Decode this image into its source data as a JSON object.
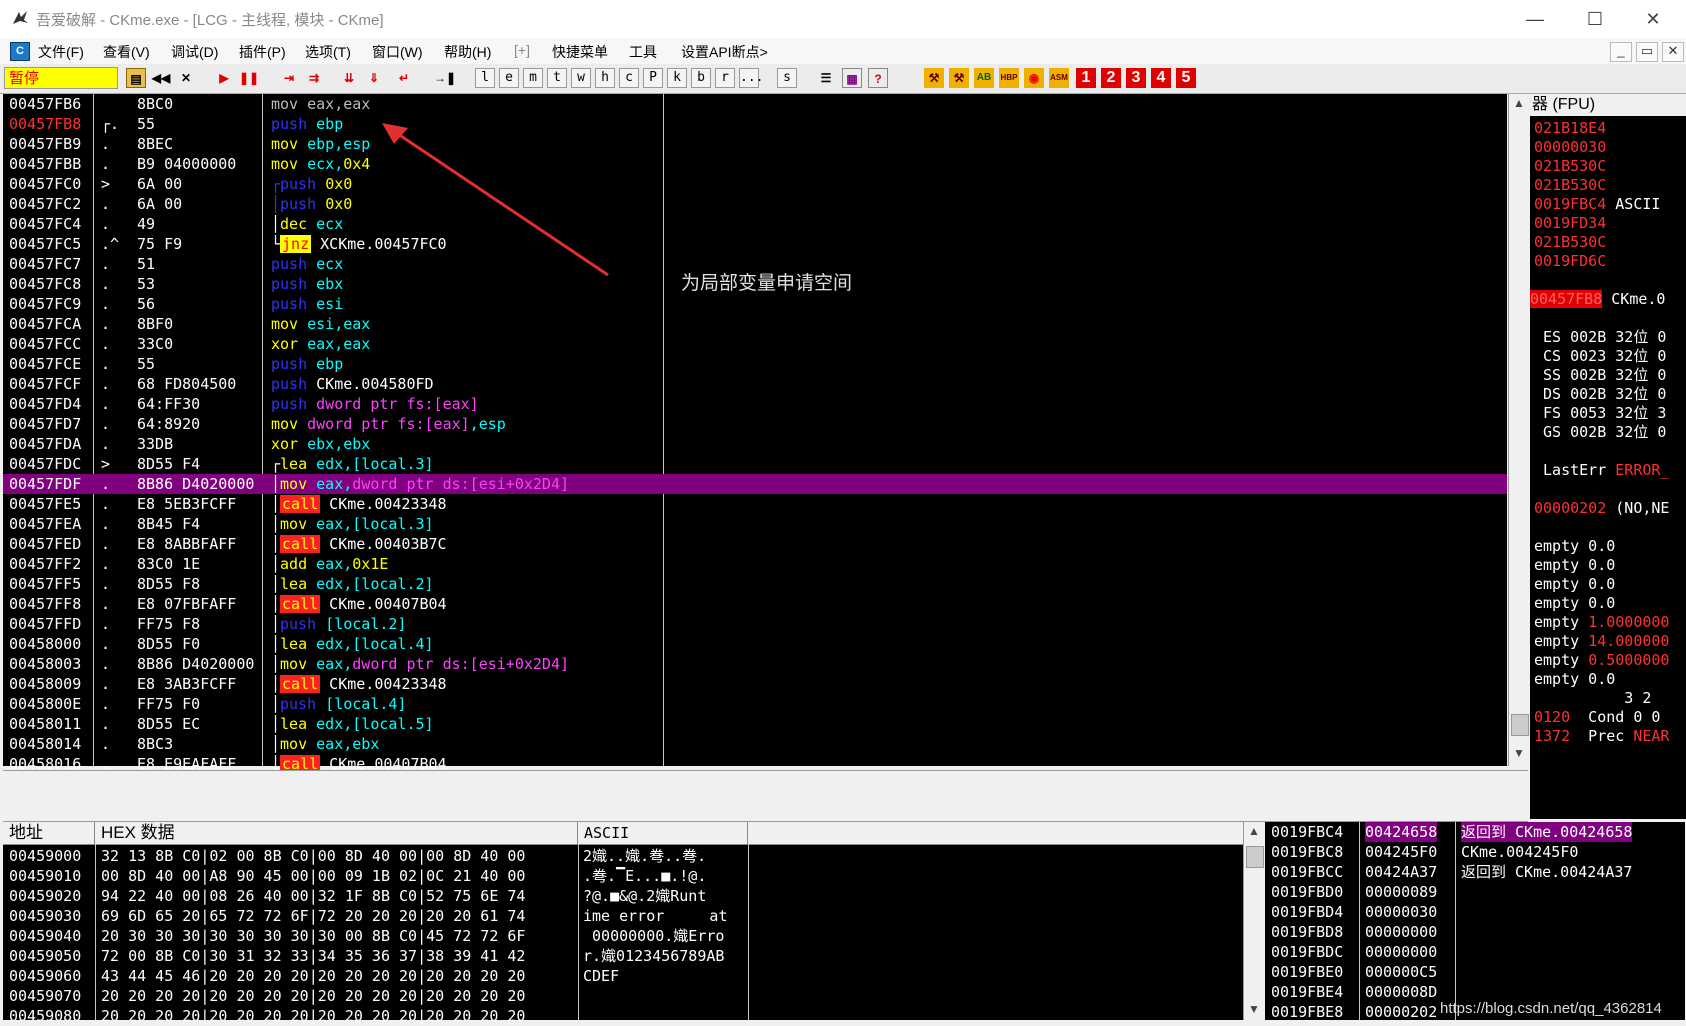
{
  "window": {
    "title": "吾爱破解 - CKme.exe - [LCG - 主线程, 模块 - CKme]",
    "controls": {
      "minimize": "—",
      "maximize": "☐",
      "close": "✕"
    }
  },
  "menu": {
    "items": [
      "文件(F)",
      "查看(V)",
      "调试(D)",
      "插件(P)",
      "选项(T)",
      "窗口(W)",
      "帮助(H)",
      "[+]",
      "快捷菜单",
      "工具",
      "设置API断点>"
    ],
    "mdi": [
      "_",
      "▭",
      "✕"
    ]
  },
  "toolbar": {
    "status": "暂停",
    "letters": [
      "l",
      "e",
      "m",
      "t",
      "w",
      "h",
      "c",
      "P",
      "k",
      "b",
      "r",
      "...",
      "s"
    ],
    "numbers": [
      "1",
      "2",
      "3",
      "4",
      "5"
    ]
  },
  "disasm": {
    "rows": [
      {
        "addr": "00457FB6",
        "mark": "",
        "hex": "8BC0",
        "dis": [
          [
            "greytxt",
            "mov eax,eax"
          ]
        ]
      },
      {
        "addr": "00457FB8",
        "mark": "┌.",
        "hex": "55",
        "dis": [
          [
            "kw-push",
            "push "
          ],
          [
            "reg",
            "ebp"
          ]
        ],
        "hl": true
      },
      {
        "addr": "00457FB9",
        "mark": ".",
        "hex": "8BEC",
        "dis": [
          [
            "kw-mov",
            "mov "
          ],
          [
            "reg",
            "ebp,esp"
          ]
        ]
      },
      {
        "addr": "00457FBB",
        "mark": ".",
        "hex": "B9 04000000",
        "dis": [
          [
            "kw-mov",
            "mov "
          ],
          [
            "reg",
            "ecx,"
          ],
          [
            "num-c",
            "0x4"
          ]
        ]
      },
      {
        "addr": "00457FC0",
        "mark": ">",
        "hex": "6A 00",
        "dis": [
          [
            "kw-push",
            "┌push "
          ],
          [
            "num-c",
            "0x0"
          ]
        ]
      },
      {
        "addr": "00457FC2",
        "mark": ".",
        "hex": "6A 00",
        "dis": [
          [
            "kw-push",
            "│push "
          ],
          [
            "num-c",
            "0x0"
          ]
        ]
      },
      {
        "addr": "00457FC4",
        "mark": ".",
        "hex": "49",
        "dis": [
          [
            "white",
            "│"
          ],
          [
            "kw-mov",
            "dec "
          ],
          [
            "reg",
            "ecx"
          ]
        ]
      },
      {
        "addr": "00457FC5",
        "mark": ".^",
        "hex": "75 F9",
        "dis": [
          [
            "white",
            "└"
          ],
          [
            "kw-jnz",
            "jnz"
          ],
          [
            "white",
            " XCKme.00457FC0"
          ]
        ]
      },
      {
        "addr": "00457FC7",
        "mark": ".",
        "hex": "51",
        "dis": [
          [
            "kw-push",
            "push "
          ],
          [
            "reg",
            "ecx"
          ]
        ]
      },
      {
        "addr": "00457FC8",
        "mark": ".",
        "hex": "53",
        "dis": [
          [
            "kw-push",
            "push "
          ],
          [
            "reg",
            "ebx"
          ]
        ]
      },
      {
        "addr": "00457FC9",
        "mark": ".",
        "hex": "56",
        "dis": [
          [
            "kw-push",
            "push "
          ],
          [
            "reg",
            "esi"
          ]
        ]
      },
      {
        "addr": "00457FCA",
        "mark": ".",
        "hex": "8BF0",
        "dis": [
          [
            "kw-mov",
            "mov "
          ],
          [
            "reg",
            "esi,eax"
          ]
        ]
      },
      {
        "addr": "00457FCC",
        "mark": ".",
        "hex": "33C0",
        "dis": [
          [
            "kw-mov",
            "xor "
          ],
          [
            "reg",
            "eax,eax"
          ]
        ]
      },
      {
        "addr": "00457FCE",
        "mark": ".",
        "hex": "55",
        "dis": [
          [
            "kw-push",
            "push "
          ],
          [
            "reg",
            "ebp"
          ]
        ]
      },
      {
        "addr": "00457FCF",
        "mark": ".",
        "hex": "68 FD804500",
        "dis": [
          [
            "kw-push",
            "push "
          ],
          [
            "white",
            "CKme.004580FD"
          ]
        ]
      },
      {
        "addr": "00457FD4",
        "mark": ".",
        "hex": "64:FF30",
        "dis": [
          [
            "kw-push",
            "push "
          ],
          [
            "ptr",
            "dword ptr fs:[eax]"
          ]
        ]
      },
      {
        "addr": "00457FD7",
        "mark": ".",
        "hex": "64:8920",
        "dis": [
          [
            "kw-mov",
            "mov "
          ],
          [
            "ptr",
            "dword ptr fs:[eax]"
          ],
          [
            "reg",
            ",esp"
          ]
        ]
      },
      {
        "addr": "00457FDA",
        "mark": ".",
        "hex": "33DB",
        "dis": [
          [
            "kw-mov",
            "xor "
          ],
          [
            "reg",
            "ebx,ebx"
          ]
        ]
      },
      {
        "addr": "00457FDC",
        "mark": ">",
        "hex": "8D55 F4",
        "dis": [
          [
            "white",
            "┌"
          ],
          [
            "kw-mov",
            "lea "
          ],
          [
            "reg",
            "edx,[local.3]"
          ]
        ]
      },
      {
        "addr": "00457FDF",
        "mark": ".",
        "hex": "8B86 D4020000",
        "dis": [
          [
            "white",
            "│"
          ],
          [
            "kw-mov",
            "mov "
          ],
          [
            "reg",
            "eax,"
          ],
          [
            "ptr",
            "dword ptr ds:[esi+0x2D4]"
          ]
        ],
        "sel": true
      },
      {
        "addr": "00457FE5",
        "mark": ".",
        "hex": "E8 5EB3FCFF",
        "dis": [
          [
            "white",
            "│"
          ],
          [
            "kw-call",
            "call"
          ],
          [
            "white",
            " CKme.00423348"
          ]
        ]
      },
      {
        "addr": "00457FEA",
        "mark": ".",
        "hex": "8B45 F4",
        "dis": [
          [
            "white",
            "│"
          ],
          [
            "kw-mov",
            "mov "
          ],
          [
            "reg",
            "eax,[local.3]"
          ]
        ]
      },
      {
        "addr": "00457FED",
        "mark": ".",
        "hex": "E8 8ABBFAFF",
        "dis": [
          [
            "white",
            "│"
          ],
          [
            "kw-call",
            "call"
          ],
          [
            "white",
            " CKme.00403B7C"
          ]
        ]
      },
      {
        "addr": "00457FF2",
        "mark": ".",
        "hex": "83C0 1E",
        "dis": [
          [
            "white",
            "│"
          ],
          [
            "kw-mov",
            "add "
          ],
          [
            "reg",
            "eax,"
          ],
          [
            "num-c",
            "0x1E"
          ]
        ]
      },
      {
        "addr": "00457FF5",
        "mark": ".",
        "hex": "8D55 F8",
        "dis": [
          [
            "white",
            "│"
          ],
          [
            "kw-mov",
            "lea "
          ],
          [
            "reg",
            "edx,[local.2]"
          ]
        ]
      },
      {
        "addr": "00457FF8",
        "mark": ".",
        "hex": "E8 07FBFAFF",
        "dis": [
          [
            "white",
            "│"
          ],
          [
            "kw-call",
            "call"
          ],
          [
            "white",
            " CKme.00407B04"
          ]
        ]
      },
      {
        "addr": "00457FFD",
        "mark": ".",
        "hex": "FF75 F8",
        "dis": [
          [
            "white",
            "│"
          ],
          [
            "kw-push",
            "push "
          ],
          [
            "reg",
            "[local.2]"
          ]
        ]
      },
      {
        "addr": "00458000",
        "mark": ".",
        "hex": "8D55 F0",
        "dis": [
          [
            "white",
            "│"
          ],
          [
            "kw-mov",
            "lea "
          ],
          [
            "reg",
            "edx,[local.4]"
          ]
        ]
      },
      {
        "addr": "00458003",
        "mark": ".",
        "hex": "8B86 D4020000",
        "dis": [
          [
            "white",
            "│"
          ],
          [
            "kw-mov",
            "mov "
          ],
          [
            "reg",
            "eax,"
          ],
          [
            "ptr",
            "dword ptr ds:[esi+0x2D4]"
          ]
        ]
      },
      {
        "addr": "00458009",
        "mark": ".",
        "hex": "E8 3AB3FCFF",
        "dis": [
          [
            "white",
            "│"
          ],
          [
            "kw-call",
            "call"
          ],
          [
            "white",
            " CKme.00423348"
          ]
        ]
      },
      {
        "addr": "0045800E",
        "mark": ".",
        "hex": "FF75 F0",
        "dis": [
          [
            "white",
            "│"
          ],
          [
            "kw-push",
            "push "
          ],
          [
            "reg",
            "[local.4]"
          ]
        ]
      },
      {
        "addr": "00458011",
        "mark": ".",
        "hex": "8D55 EC",
        "dis": [
          [
            "white",
            "│"
          ],
          [
            "kw-mov",
            "lea "
          ],
          [
            "reg",
            "edx,[local.5]"
          ]
        ]
      },
      {
        "addr": "00458014",
        "mark": ".",
        "hex": "8BC3",
        "dis": [
          [
            "white",
            "│"
          ],
          [
            "kw-mov",
            "mov "
          ],
          [
            "reg",
            "eax,ebx"
          ]
        ]
      },
      {
        "addr": "00458016",
        "mark": ".",
        "hex": "E8 E9EAFAFF",
        "dis": [
          [
            "white",
            "│"
          ],
          [
            "kw-call",
            "call"
          ],
          [
            "white",
            " CKme.00407B04"
          ]
        ]
      }
    ],
    "comment": "为局部变量申请空间"
  },
  "registers": {
    "header": "器 (FPU)",
    "lines": [
      [
        [
          "red",
          "021B18E4"
        ]
      ],
      [
        [
          "red",
          "00000030"
        ]
      ],
      [
        [
          "red",
          "021B530C"
        ]
      ],
      [
        [
          "red",
          "021B530C"
        ]
      ],
      [
        [
          "red",
          "0019FBC4"
        ],
        [
          "white",
          " ASCII"
        ]
      ],
      [
        [
          "red",
          "0019FD34"
        ]
      ],
      [
        [
          "red",
          "021B530C"
        ]
      ],
      [
        [
          "red",
          "0019FD6C"
        ]
      ],
      [
        [
          "white",
          ""
        ]
      ],
      [
        [
          "red",
          "00457FB8"
        ],
        [
          "white",
          " CKme.0"
        ]
      ],
      [
        [
          "white",
          ""
        ]
      ],
      [
        [
          "white",
          " ES 002B 32位 0"
        ]
      ],
      [
        [
          "white",
          " CS 0023 32位 0"
        ]
      ],
      [
        [
          "white",
          " SS 002B 32位 0"
        ]
      ],
      [
        [
          "white",
          " DS 002B 32位 0"
        ]
      ],
      [
        [
          "white",
          " FS 0053 32位 3"
        ]
      ],
      [
        [
          "white",
          " GS 002B 32位 0"
        ]
      ],
      [
        [
          "white",
          ""
        ]
      ],
      [
        [
          "white",
          " LastErr "
        ],
        [
          "red",
          "ERROR_"
        ]
      ],
      [
        [
          "white",
          ""
        ]
      ],
      [
        [
          "red",
          "00000202"
        ],
        [
          "white",
          " (NO,NE"
        ]
      ],
      [
        [
          "white",
          ""
        ]
      ],
      [
        [
          "white",
          "empty 0.0"
        ]
      ],
      [
        [
          "white",
          "empty 0.0"
        ]
      ],
      [
        [
          "white",
          "empty 0.0"
        ]
      ],
      [
        [
          "white",
          "empty 0.0"
        ]
      ],
      [
        [
          "white",
          "empty "
        ],
        [
          "red",
          "1.0000000"
        ]
      ],
      [
        [
          "white",
          "empty "
        ],
        [
          "red",
          "14.000000"
        ]
      ],
      [
        [
          "white",
          "empty "
        ],
        [
          "red",
          "0.5000000"
        ]
      ],
      [
        [
          "white",
          "empty 0.0"
        ]
      ],
      [
        [
          "white",
          "          3 2"
        ]
      ],
      [
        [
          "red",
          "0120"
        ],
        [
          "white",
          "  Cond 0 0"
        ]
      ],
      [
        [
          "red",
          "1372"
        ],
        [
          "white",
          "  Prec "
        ],
        [
          "red",
          "NEAR"
        ]
      ]
    ]
  },
  "dump": {
    "headers": [
      "地址",
      "HEX 数据",
      "ASCII"
    ],
    "rows": [
      {
        "addr": "00459000",
        "hex": "32 13 8B C0|02 00 8B C0|00 8D 40 00|00 8D 40 00",
        "ascii": "2嬂..嬂.弮..弮."
      },
      {
        "addr": "00459010",
        "hex": "00 8D 40 00|A8 90 45 00|00 09 1B 02|0C 21 40 00",
        "ascii": ".弮.▔E...■.!@."
      },
      {
        "addr": "00459020",
        "hex": "94 22 40 00|08 26 40 00|32 1F 8B C0|52 75 6E 74",
        "ascii": "?@.■&@.2嬂Runt"
      },
      {
        "addr": "00459030",
        "hex": "69 6D 65 20|65 72 72 6F|72 20 20 20|20 20 61 74",
        "ascii": "ime error     at"
      },
      {
        "addr": "00459040",
        "hex": "20 30 30 30|30 30 30 30|30 00 8B C0|45 72 72 6F",
        "ascii": " 00000000.嬂Erro"
      },
      {
        "addr": "00459050",
        "hex": "72 00 8B C0|30 31 32 33|34 35 36 37|38 39 41 42",
        "ascii": "r.嬂0123456789AB"
      },
      {
        "addr": "00459060",
        "hex": "43 44 45 46|20 20 20 20|20 20 20 20|20 20 20 20",
        "ascii": "CDEF"
      },
      {
        "addr": "00459070",
        "hex": "20 20 20 20|20 20 20 20|20 20 20 20|20 20 20 20",
        "ascii": ""
      },
      {
        "addr": "00459080",
        "hex": "20 20 20 20|20 20 20 20|20 20 20 20|20 20 20 20",
        "ascii": ""
      }
    ]
  },
  "stack": {
    "rows": [
      {
        "addr": "0019FBC4",
        "val": "00424658",
        "cmt": "返回到 CKme.00424658"
      },
      {
        "addr": "0019FBC8",
        "val": "004245F0",
        "cmt": "CKme.004245F0"
      },
      {
        "addr": "0019FBCC",
        "val": "00424A37",
        "cmt": "返回到 CKme.00424A37"
      },
      {
        "addr": "0019FBD0",
        "val": "00000089",
        "cmt": ""
      },
      {
        "addr": "0019FBD4",
        "val": "00000030",
        "cmt": ""
      },
      {
        "addr": "0019FBD8",
        "val": "00000000",
        "cmt": ""
      },
      {
        "addr": "0019FBDC",
        "val": "00000000",
        "cmt": ""
      },
      {
        "addr": "0019FBE0",
        "val": "000000C5",
        "cmt": ""
      },
      {
        "addr": "0019FBE4",
        "val": "0000008D",
        "cmt": ""
      },
      {
        "addr": "0019FBE8",
        "val": "00000202",
        "cmt": ""
      }
    ]
  },
  "watermark": "https://blog.csdn.net/qq_4362814"
}
